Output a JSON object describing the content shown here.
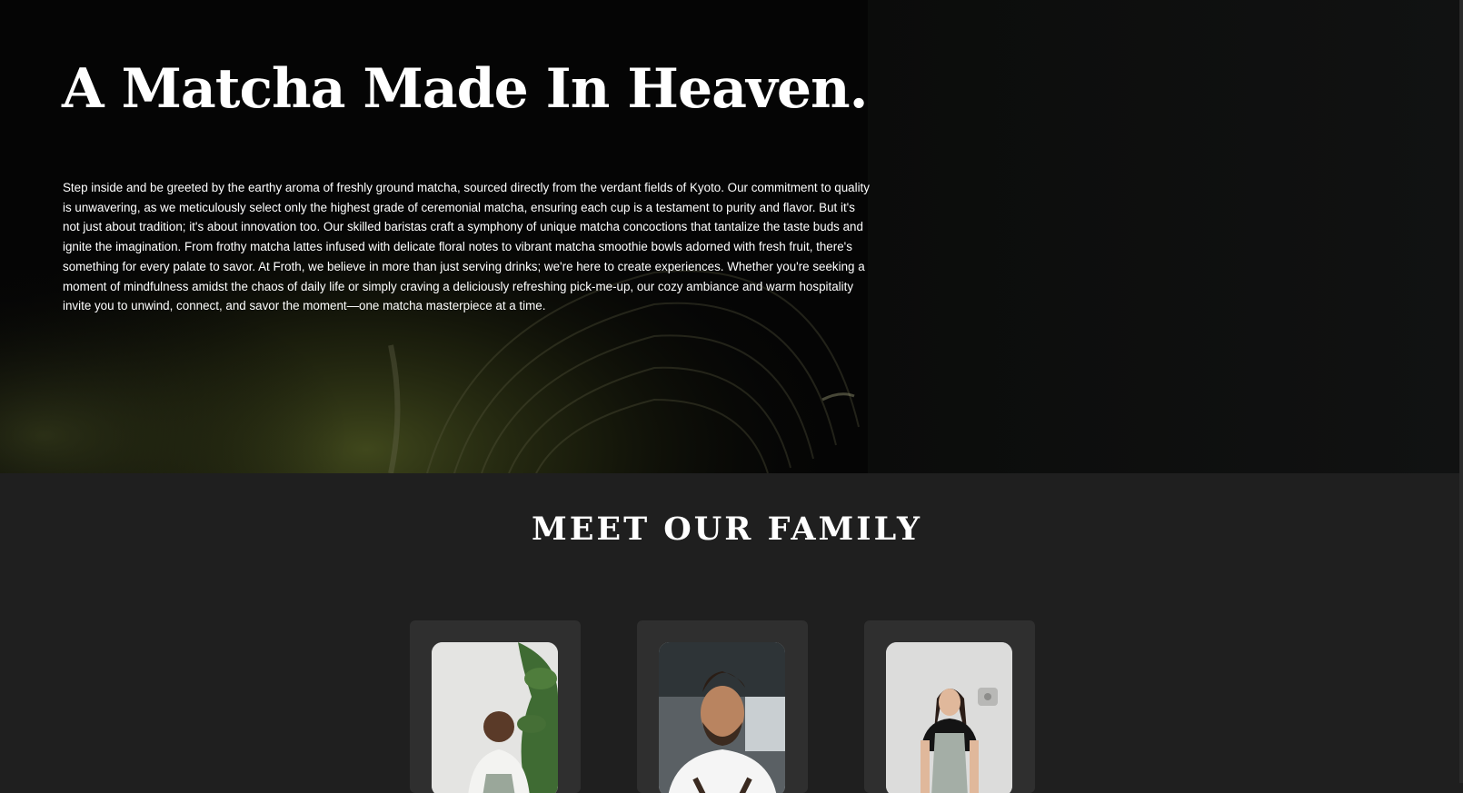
{
  "hero": {
    "title": "A Matcha Made In Heaven.",
    "body": "Step inside and be greeted by the earthy aroma of freshly ground matcha, sourced directly from the verdant fields of Kyoto. Our commitment to quality is unwavering, as we meticulously select only the highest grade of ceremonial matcha, ensuring each cup is a testament to purity and flavor. But it's not just about tradition; it's about innovation too. Our skilled baristas craft a symphony of unique matcha concoctions that tantalize the taste buds and ignite the imagination. From frothy matcha lattes infused with delicate floral notes to vibrant matcha smoothie bowls adorned with fresh fruit, there's something for every palate to savor. At Froth, we believe in more than just serving drinks; we're here to create experiences. Whether you're seeking a moment of mindfulness amidst the chaos of daily life or simply craving a deliciously refreshing pick-me-up, our cozy ambiance and warm hospitality invite you to unwind, connect, and savor the moment—one matcha masterpiece at a time."
  },
  "family": {
    "title": "MEET OUR FAMILY"
  },
  "colors": {
    "hero_background": "#050505",
    "section_background": "#1f1f1f",
    "card_background": "#2f2f2f",
    "matcha_accent": "#5b6a2a",
    "text": "#ffffff"
  }
}
